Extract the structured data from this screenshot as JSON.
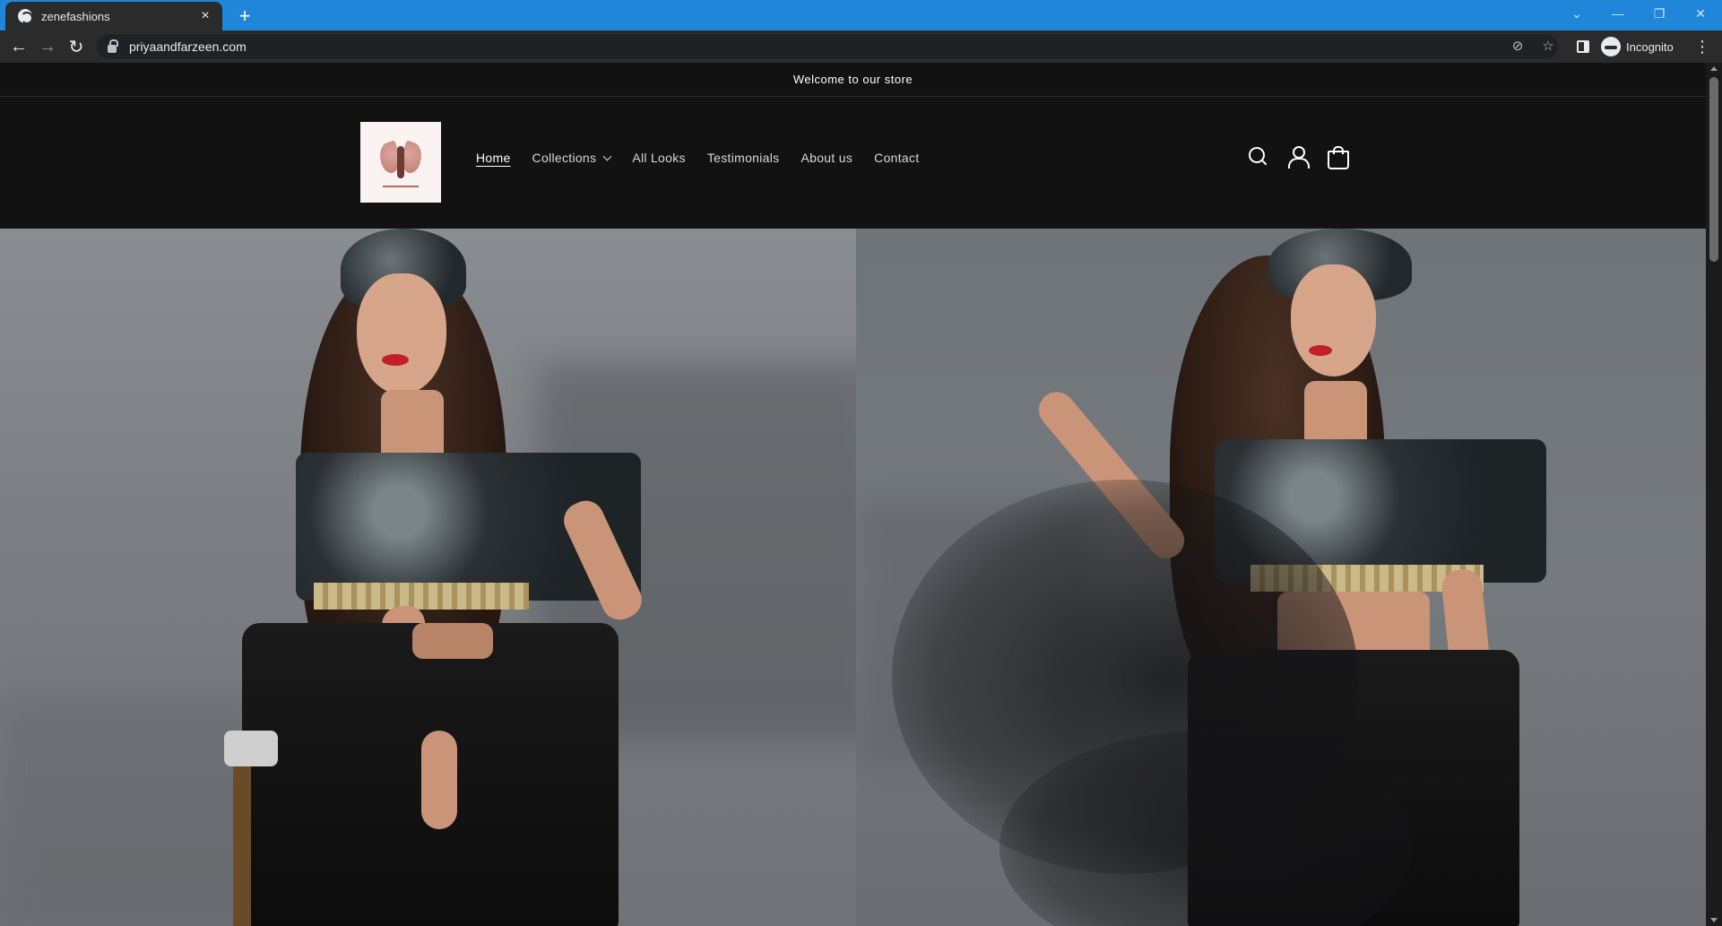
{
  "browser": {
    "tab_title": "zenefashions",
    "tab_close": "×",
    "new_tab": "+",
    "url": "priyaandfarzeen.com",
    "profile_label": "Incognito",
    "back_glyph": "←",
    "forward_glyph": "→",
    "reload_glyph": "↻",
    "menu_glyph": "⋮",
    "window_controls": [
      "⌄",
      "—",
      "❐",
      "✕"
    ],
    "omnibox_icons": [
      "eye-off-icon",
      "star-icon"
    ],
    "accent_color": "#1f86d9"
  },
  "store": {
    "announcement": "Welcome to our store",
    "nav": [
      {
        "label": "Home",
        "active": true
      },
      {
        "label": "Collections",
        "has_dropdown": true
      },
      {
        "label": "All Looks"
      },
      {
        "label": "Testimonials"
      },
      {
        "label": "About us"
      },
      {
        "label": "Contact"
      }
    ],
    "header_icons": [
      "search-icon",
      "account-icon",
      "cart-icon"
    ],
    "background_color": "#121212"
  }
}
